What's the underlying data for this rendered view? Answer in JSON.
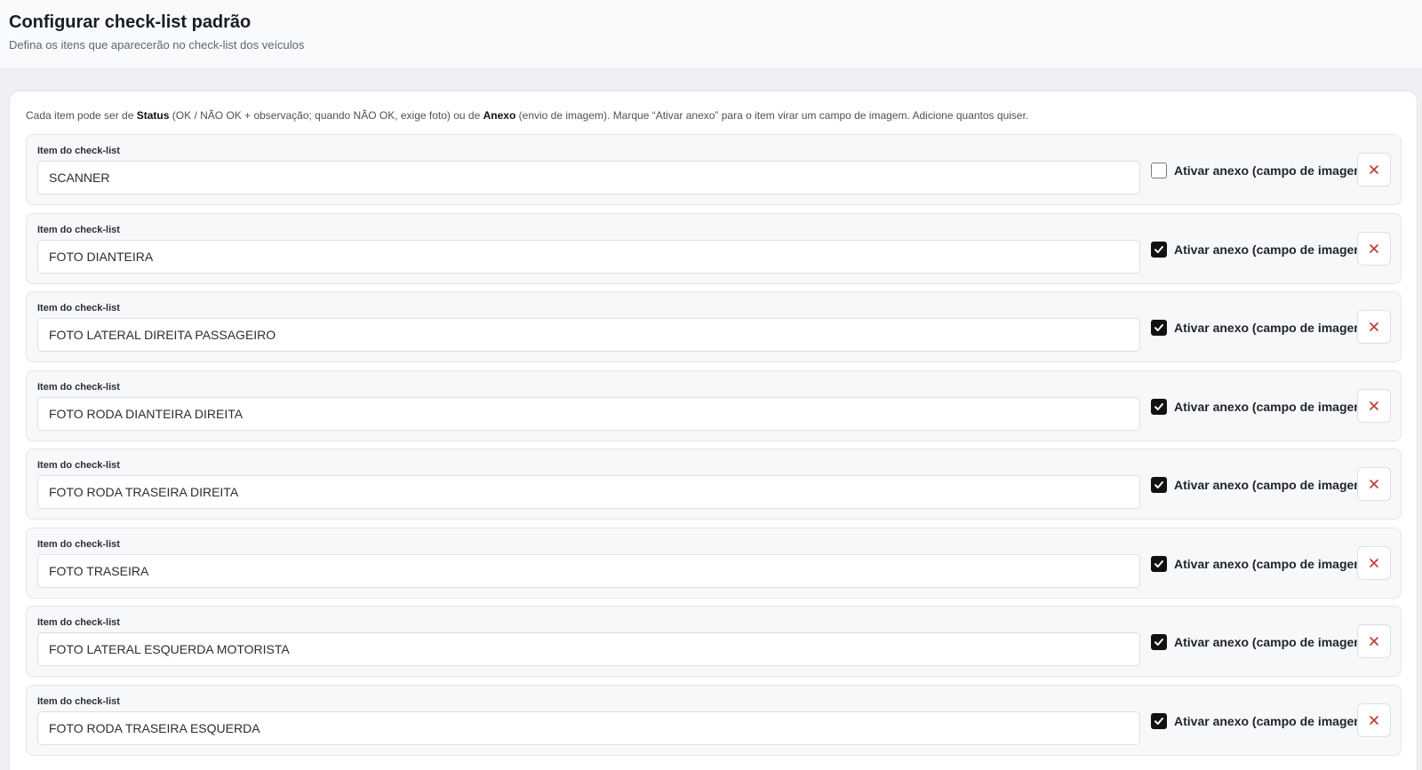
{
  "header": {
    "title": "Configurar check-list padrão",
    "subtitle": "Defina os itens que aparecerão no check-list dos veículos"
  },
  "help": {
    "p1": "Cada item pode ser de ",
    "status_bold": "Status",
    "p2": " (OK / NÃO OK + observação; quando NÃO OK, exige foto) ou de ",
    "anexo_bold": "Anexo",
    "p3": " (envio de imagem). Marque “Ativar anexo” para o item virar um campo de imagem. Adicione quantos quiser."
  },
  "items": [
    {
      "label": "Item do check-list",
      "value": "SCANNER",
      "attach_label": "Ativar anexo (campo de imagem)",
      "attach_checked": false
    },
    {
      "label": "Item do check-list",
      "value": "FOTO DIANTEIRA",
      "attach_label": "Ativar anexo (campo de imagem)",
      "attach_checked": true
    },
    {
      "label": "Item do check-list",
      "value": "FOTO LATERAL DIREITA PASSAGEIRO",
      "attach_label": "Ativar anexo (campo de imagem)",
      "attach_checked": true
    },
    {
      "label": "Item do check-list",
      "value": "FOTO RODA DIANTEIRA DIREITA",
      "attach_label": "Ativar anexo (campo de imagem)",
      "attach_checked": true
    },
    {
      "label": "Item do check-list",
      "value": "FOTO RODA TRASEIRA DIREITA",
      "attach_label": "Ativar anexo (campo de imagem)",
      "attach_checked": true
    },
    {
      "label": "Item do check-list",
      "value": "FOTO TRASEIRA",
      "attach_label": "Ativar anexo (campo de imagem)",
      "attach_checked": true
    },
    {
      "label": "Item do check-list",
      "value": "FOTO LATERAL ESQUERDA MOTORISTA",
      "attach_label": "Ativar anexo (campo de imagem)",
      "attach_checked": true
    },
    {
      "label": "Item do check-list",
      "value": "FOTO RODA TRASEIRA ESQUERDA",
      "attach_label": "Ativar anexo (campo de imagem)",
      "attach_checked": true
    }
  ],
  "icons": {
    "remove": "close-icon",
    "check": "checkmark-icon"
  },
  "colors": {
    "remove_icon": "#c0392b",
    "checkbox_checked": "#111111",
    "page_background": "#eef0f3"
  }
}
